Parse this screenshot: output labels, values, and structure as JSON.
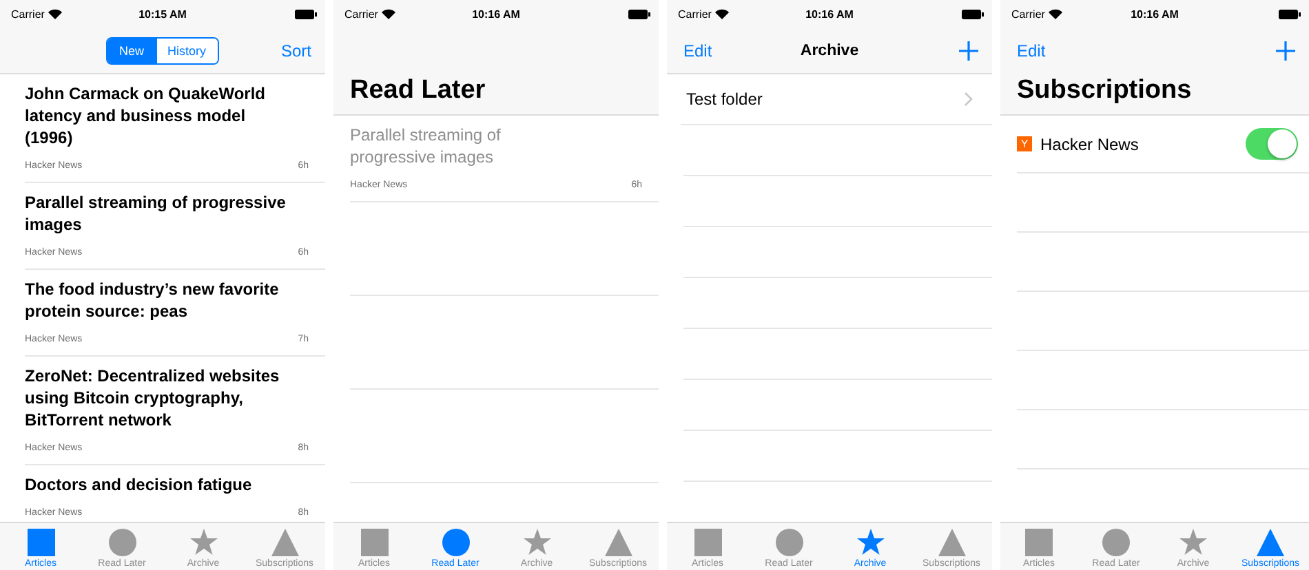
{
  "screens": [
    {
      "kind": "articles",
      "status_bar": {
        "carrier": "Carrier",
        "time": "10:15 AM"
      },
      "segments": [
        {
          "label": "New",
          "selected": true
        },
        {
          "label": "History",
          "selected": false
        }
      ],
      "nav_right": "Sort",
      "articles": [
        {
          "title": "John Carmack on QuakeWorld latency and business model (1996)",
          "source": "Hacker News",
          "age": "6h",
          "read": false
        },
        {
          "title": "Parallel streaming of progressive images",
          "source": "Hacker News",
          "age": "6h",
          "read": false
        },
        {
          "title": "The food industry’s new favorite protein source: peas",
          "source": "Hacker News",
          "age": "7h",
          "read": false
        },
        {
          "title": "ZeroNet: Decentralized websites using Bitcoin cryptography, BitTorrent network",
          "source": "Hacker News",
          "age": "8h",
          "read": false
        },
        {
          "title": "Doctors and decision fatigue",
          "source": "Hacker News",
          "age": "8h",
          "read": false
        }
      ],
      "tab_bar": [
        {
          "label": "Articles",
          "kind": "square",
          "selected": true
        },
        {
          "label": "Read Later",
          "kind": "circle",
          "selected": false
        },
        {
          "label": "Archive",
          "kind": "star",
          "selected": false
        },
        {
          "label": "Subscriptions",
          "kind": "triangle",
          "selected": false
        }
      ]
    },
    {
      "kind": "read_later",
      "status_bar": {
        "carrier": "Carrier",
        "time": "10:16 AM"
      },
      "large_title": "Read Later",
      "articles": [
        {
          "title": "Parallel streaming of progressive images",
          "source": "Hacker News",
          "age": "6h",
          "read": true
        }
      ],
      "tab_bar": [
        {
          "label": "Articles",
          "kind": "square",
          "selected": false
        },
        {
          "label": "Read Later",
          "kind": "circle",
          "selected": true
        },
        {
          "label": "Archive",
          "kind": "star",
          "selected": false
        },
        {
          "label": "Subscriptions",
          "kind": "triangle",
          "selected": false
        }
      ]
    },
    {
      "kind": "archive",
      "status_bar": {
        "carrier": "Carrier",
        "time": "10:16 AM"
      },
      "nav_left": "Edit",
      "nav_title": "Archive",
      "folders": [
        {
          "name": "Test folder"
        }
      ],
      "tab_bar": [
        {
          "label": "Articles",
          "kind": "square",
          "selected": false
        },
        {
          "label": "Read Later",
          "kind": "circle",
          "selected": false
        },
        {
          "label": "Archive",
          "kind": "star",
          "selected": true
        },
        {
          "label": "Subscriptions",
          "kind": "triangle",
          "selected": false
        }
      ]
    },
    {
      "kind": "subscriptions",
      "status_bar": {
        "carrier": "Carrier",
        "time": "10:16 AM"
      },
      "nav_left": "Edit",
      "large_title": "Subscriptions",
      "subscriptions": [
        {
          "name": "Hacker News",
          "badge": "Y",
          "on": true
        }
      ],
      "tab_bar": [
        {
          "label": "Articles",
          "kind": "square",
          "selected": false
        },
        {
          "label": "Read Later",
          "kind": "circle",
          "selected": false
        },
        {
          "label": "Archive",
          "kind": "star",
          "selected": false
        },
        {
          "label": "Subscriptions",
          "kind": "triangle",
          "selected": true
        }
      ]
    }
  ]
}
